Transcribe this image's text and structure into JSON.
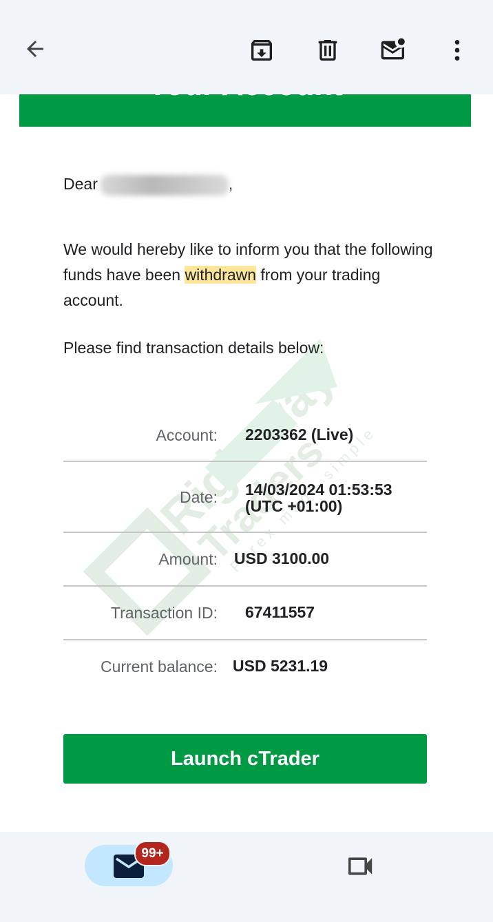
{
  "topbar": {
    "back_icon": "arrow-left-icon",
    "archive_icon": "archive-icon",
    "delete_icon": "trash-icon",
    "mark_unread_icon": "mail-unread-icon",
    "more_icon": "more-vert-icon"
  },
  "email": {
    "banner_title": "Your Account",
    "greeting": "Dear",
    "greeting_punct": ",",
    "paragraph_before": "We would hereby like to inform you that the following funds have been ",
    "paragraph_highlight": "withdrawn",
    "paragraph_after": " from your trading account.",
    "details_intro": "Please find transaction details below:",
    "details": [
      {
        "label": "Account:",
        "value": "2203362 (Live)"
      },
      {
        "label": "Date:",
        "value_line1": "14/03/2024 01:53:53",
        "value_line2": "(UTC +01:00)"
      },
      {
        "label": "Amount:",
        "value": "USD 3100.00"
      },
      {
        "label": "Transaction ID:",
        "value": "67411557"
      },
      {
        "label": "Current balance:",
        "value": "USD 5231.19"
      }
    ],
    "cta_label": "Launch cTrader",
    "watermark": {
      "line1": "Rightway",
      "line2": "Traders",
      "tagline": "Forex made simple"
    }
  },
  "bottom_nav": {
    "mail_badge": "99+",
    "mail_icon": "mail-icon",
    "meet_icon": "video-camera-icon"
  },
  "colors": {
    "brand_green": "#009a44",
    "highlight": "#fde69a",
    "badge_red": "#b3261e",
    "pill_blue": "#c2e7ff"
  }
}
